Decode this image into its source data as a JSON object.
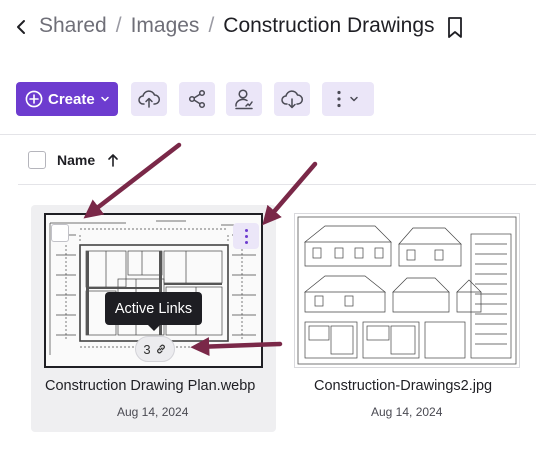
{
  "breadcrumb": {
    "items": [
      "Shared",
      "Images"
    ],
    "separator": "/",
    "current": "Construction Drawings"
  },
  "toolbar": {
    "create_label": "Create",
    "buttons": [
      "cloud-upload-icon",
      "share-icon",
      "user-sign-icon",
      "cloud-download-icon",
      "more-vertical-icon"
    ]
  },
  "list_header": {
    "sort_label": "Name",
    "sort_direction": "ascending"
  },
  "files": [
    {
      "name": "Construction Drawing Plan.webp",
      "date": "Aug 14, 2024",
      "selected": true,
      "links_count": "3"
    },
    {
      "name": "Construction-Drawings2.jpg",
      "date": "Aug 14, 2024",
      "selected": false
    }
  ],
  "tooltip": {
    "text": "Active Links"
  },
  "colors": {
    "accent": "#6d3ccf",
    "accent_light": "#ebe6f8",
    "annotation_arrow": "#7a2848",
    "tooltip_bg": "#1e1e23"
  }
}
